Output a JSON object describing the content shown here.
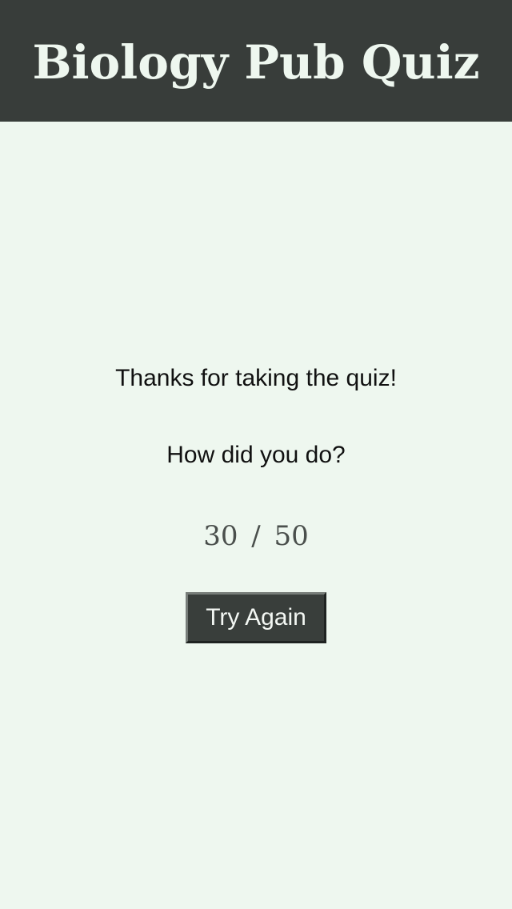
{
  "app": {
    "title": "Biology Pub Quiz"
  },
  "results": {
    "thanks": "Thanks for taking the quiz!",
    "prompt": "How did you do?",
    "score": {
      "correct": 30,
      "separator": "/",
      "total": 50
    },
    "retry_label": "Try Again"
  },
  "theme": {
    "header_bg": "#383d3a",
    "page_bg": "#eef7ef",
    "button_bg": "#393e3b"
  }
}
